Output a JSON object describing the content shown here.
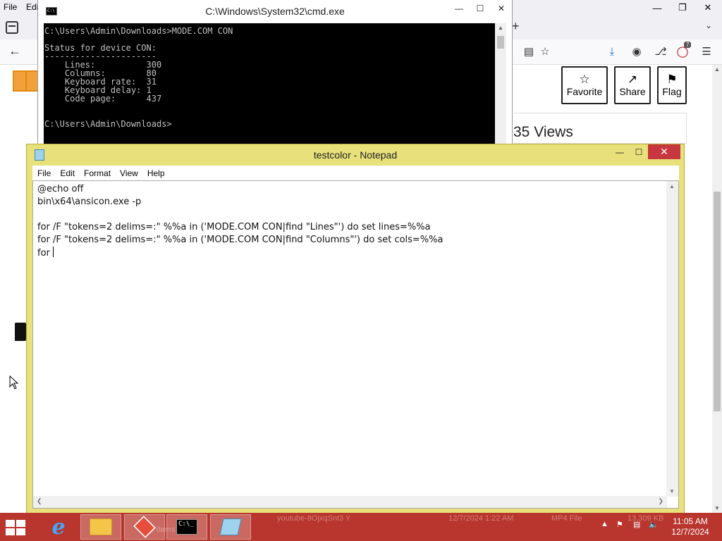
{
  "browser": {
    "menu": [
      "File",
      "Edi"
    ],
    "tabs_dropdown": "⌵",
    "new_tab": "+",
    "extension_badge": "7",
    "actions": {
      "favorite": "Favorite",
      "share": "Share",
      "flag": "Flag"
    },
    "views_text": "35 Views"
  },
  "cmd": {
    "title": "C:\\Windows\\System32\\cmd.exe",
    "icon_text": "C:\\",
    "console_lines": [
      "C:\\Users\\Admin\\Downloads>MODE.COM CON",
      "",
      "Status for device CON:",
      "----------------------",
      "    Lines:          300",
      "    Columns:        80",
      "    Keyboard rate:  31",
      "    Keyboard delay: 1",
      "    Code page:      437",
      "",
      "",
      "C:\\Users\\Admin\\Downloads>"
    ]
  },
  "notepad": {
    "title": "testcolor - Notepad",
    "menu": [
      "File",
      "Edit",
      "Format",
      "View",
      "Help"
    ],
    "lines": [
      "@echo off",
      "bin\\x64\\ansicon.exe -p",
      "",
      "for /F \"tokens=2 delims=:\" %%a in ('MODE.COM CON|find \"Lines\"') do set lines=%%a",
      "for /F \"tokens=2 delims=:\" %%a in ('MODE.COM CON|find \"Columns\"') do set cols=%%a",
      "for "
    ]
  },
  "taskbar": {
    "cmd_icon_text": "C:\\_",
    "ghost_file_name": "youtube-8OjxqSnt3 Y",
    "ghost_date": "12/7/2024 1:22 AM",
    "ghost_type": "MP4 File",
    "ghost_size": "13,309 KB",
    "ghost_items": "items",
    "clock_time": "11:05 AM",
    "clock_date": "12/7/2024"
  },
  "colors": {
    "taskbar": "#b8362e",
    "notepad_frame": "#e8e07a",
    "close_button": "#c7373f"
  }
}
